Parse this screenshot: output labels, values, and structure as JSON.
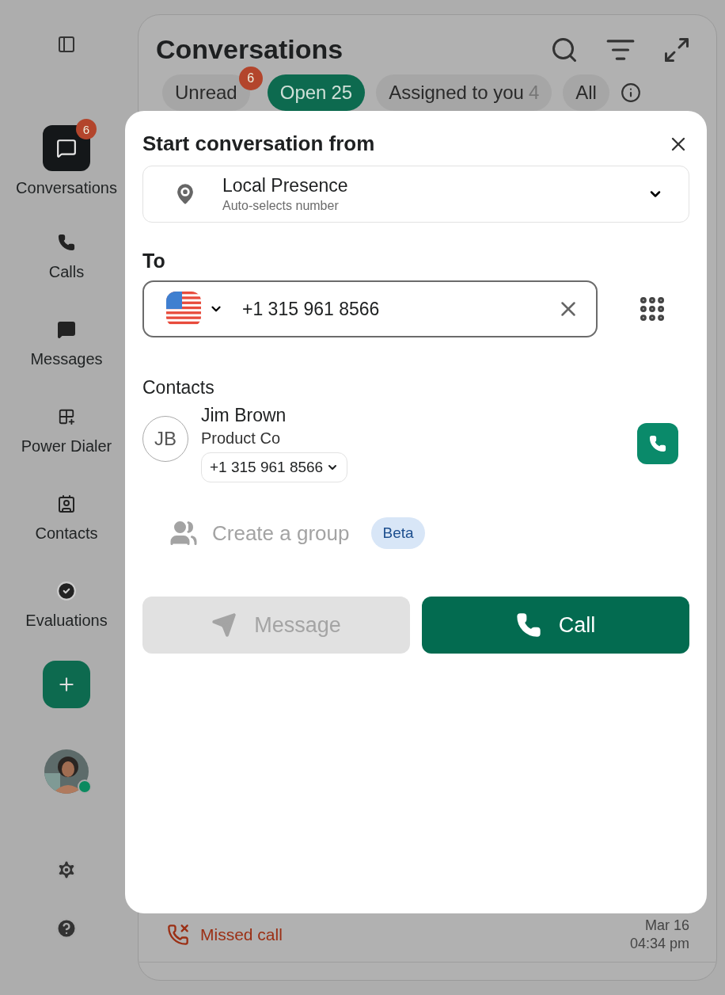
{
  "sidebar": {
    "items": [
      {
        "kind": "conversations",
        "label": "Conversations",
        "selected": true,
        "badge": "6"
      },
      {
        "kind": "calls",
        "label": "Calls",
        "selected": false
      },
      {
        "kind": "messages",
        "label": "Messages",
        "selected": false
      },
      {
        "kind": "dialer",
        "label": "Power Dialer",
        "selected": false
      },
      {
        "kind": "contacts",
        "label": "Contacts",
        "selected": false
      },
      {
        "kind": "evaluations",
        "label": "Evaluations",
        "selected": false
      }
    ]
  },
  "header": {
    "title": "Conversations"
  },
  "tabs": [
    {
      "label": "Unread",
      "selected": false,
      "badge": "6"
    },
    {
      "label": "Open",
      "count": "25",
      "selected": true
    },
    {
      "label": "Assigned to you",
      "count": "4",
      "selected": false
    },
    {
      "label": "All",
      "selected": false
    }
  ],
  "list": {
    "rows": [
      {
        "kind": "missed",
        "label": "Missed call",
        "date": "Mar 16",
        "time": "04:34 pm"
      }
    ]
  },
  "dialog": {
    "title": "Start conversation from",
    "from": {
      "name": "Local Presence",
      "detail": "Auto-selects number"
    },
    "to": {
      "label": "To",
      "value": "+1 315 961 8566"
    },
    "contacts": {
      "heading": "Contacts",
      "items": [
        {
          "initials": "JB",
          "name": "Jim Brown",
          "company": "Product Co",
          "number": "+1 315 961 8566"
        }
      ]
    },
    "group": {
      "label": "Create a group",
      "badge": "Beta",
      "disabled": true
    },
    "actions": [
      {
        "kind": "message",
        "label": "Message",
        "disabled": true
      },
      {
        "kind": "call",
        "label": "Call",
        "disabled": false
      }
    ]
  }
}
